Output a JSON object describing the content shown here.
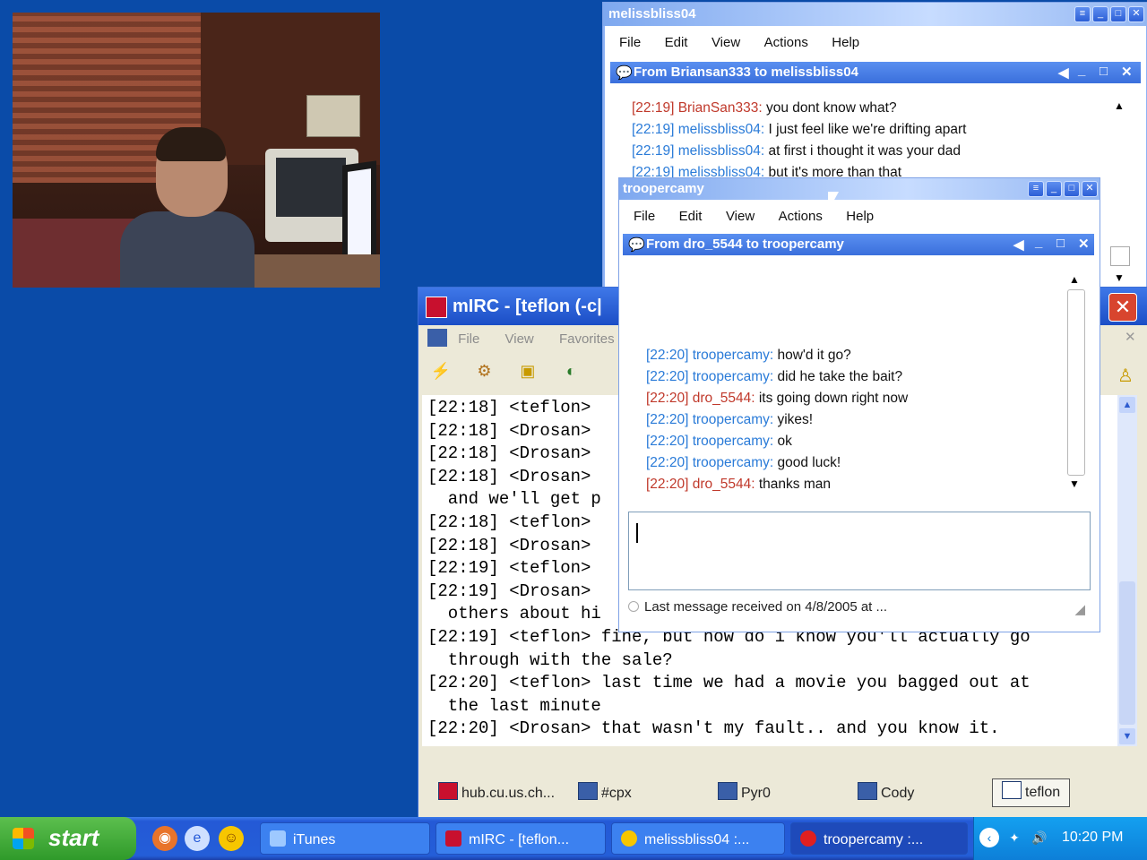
{
  "msg1": {
    "title": "melissbliss04",
    "menu": [
      "File",
      "Edit",
      "View",
      "Actions",
      "Help"
    ],
    "conversation_title": "From Briansan333 to melissbliss04",
    "messages": [
      {
        "time": "[22:19]",
        "nick": "BrianSan333:",
        "text": "you dont know what?",
        "color": "red"
      },
      {
        "time": "[22:19]",
        "nick": "melissbliss04:",
        "text": "I just feel like we're drifting apart",
        "color": "blue"
      },
      {
        "time": "[22:19]",
        "nick": "melissbliss04:",
        "text": "at first i thought it was your dad",
        "color": "blue"
      },
      {
        "time": "[22:19]",
        "nick": "melissbliss04:",
        "text": "but it's more than that",
        "color": "blue"
      }
    ]
  },
  "msg2": {
    "title": "troopercamy",
    "menu": [
      "File",
      "Edit",
      "View",
      "Actions",
      "Help"
    ],
    "conversation_title": "From dro_5544 to troopercamy",
    "messages": [
      {
        "time": "[22:20]",
        "nick": "troopercamy:",
        "text": "how'd it go?",
        "color": "blue"
      },
      {
        "time": "[22:20]",
        "nick": "troopercamy:",
        "text": "did he take the bait?",
        "color": "blue"
      },
      {
        "time": "[22:20]",
        "nick": "dro_5544:",
        "text": "its going down right now",
        "color": "red"
      },
      {
        "time": "[22:20]",
        "nick": "troopercamy:",
        "text": "yikes!",
        "color": "blue"
      },
      {
        "time": "[22:20]",
        "nick": "troopercamy:",
        "text": "ok",
        "color": "blue"
      },
      {
        "time": "[22:20]",
        "nick": "troopercamy:",
        "text": "good luck!",
        "color": "blue"
      },
      {
        "time": "[22:20]",
        "nick": "dro_5544:",
        "text": "thanks man",
        "color": "red"
      }
    ],
    "status": "Last message received on 4/8/2005 at ..."
  },
  "mirc": {
    "title": "mIRC - [teflon (-c|",
    "menu": [
      "File",
      "View",
      "Favorites"
    ],
    "chat_lines": [
      "[22:18] <teflon>",
      "[22:18] <Drosan>",
      "[22:18] <Drosan>",
      "[22:18] <Drosan>",
      "  and we'll get p",
      "[22:18] <teflon>",
      "[22:18] <Drosan>",
      "[22:19] <teflon>",
      "[22:19] <Drosan>",
      "  others about hi",
      "[22:19] <teflon> fine, but how do i know you'll actually go",
      "  through with the sale?",
      "[22:20] <teflon> last time we had a movie you bagged out at",
      "  the last minute",
      "[22:20] <Drosan> that wasn't my fault.. and you know it."
    ],
    "switchbar": [
      "hub.cu.us.ch...",
      "#cpx",
      "Pyr0",
      "Cody",
      "teflon"
    ]
  },
  "taskbar": {
    "start_label": "start",
    "buttons": [
      "iTunes",
      "mIRC - [teflon...",
      "melissbliss04 :...",
      "troopercamy :..."
    ],
    "clock": "10:20 PM"
  },
  "colors": {
    "desktop": "#0a4ba8",
    "nick_red": "#c0392b",
    "nick_blue": "#2a7bd8"
  }
}
